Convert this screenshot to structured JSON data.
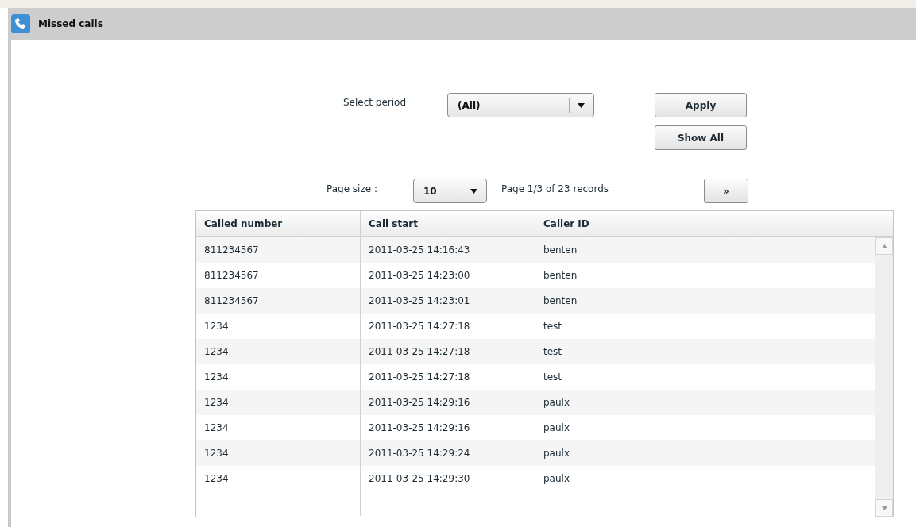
{
  "window": {
    "title": "Missed calls"
  },
  "filter": {
    "period_label": "Select period",
    "period_value": "(All)",
    "apply_button": "Apply",
    "show_all_button": "Show All"
  },
  "pager": {
    "page_size_label": "Page size :",
    "page_size_value": "10",
    "page_info": "Page 1/3 of 23 records",
    "next_button": "»"
  },
  "table": {
    "columns": [
      "Called number",
      "Call start",
      "Caller ID"
    ],
    "rows": [
      [
        "811234567",
        "2011-03-25 14:16:43",
        "benten"
      ],
      [
        "811234567",
        "2011-03-25 14:23:00",
        "benten"
      ],
      [
        "811234567",
        "2011-03-25 14:23:01",
        "benten"
      ],
      [
        "1234",
        "2011-03-25 14:27:18",
        "test"
      ],
      [
        "1234",
        "2011-03-25 14:27:18",
        "test"
      ],
      [
        "1234",
        "2011-03-25 14:27:18",
        "test"
      ],
      [
        "1234",
        "2011-03-25 14:29:16",
        "paulx"
      ],
      [
        "1234",
        "2011-03-25 14:29:16",
        "paulx"
      ],
      [
        "1234",
        "2011-03-25 14:29:24",
        "paulx"
      ],
      [
        "1234",
        "2011-03-25 14:29:30",
        "paulx"
      ]
    ]
  }
}
